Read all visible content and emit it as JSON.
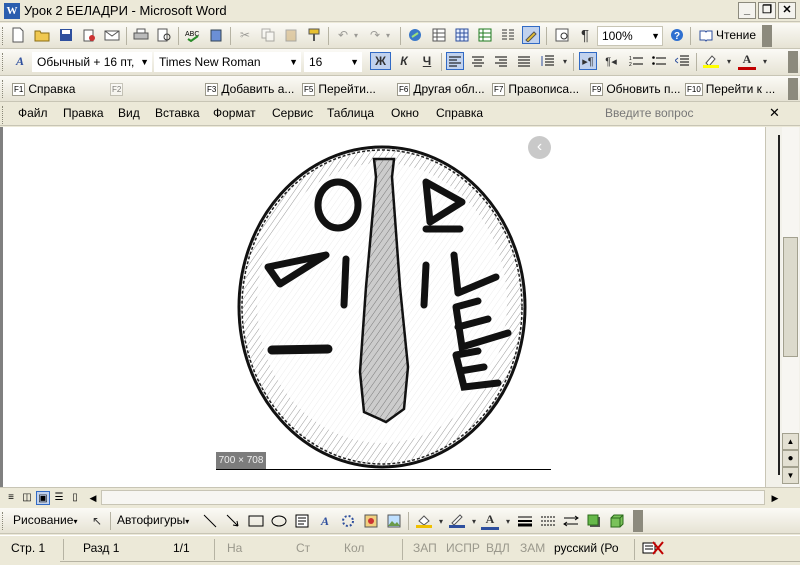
{
  "window": {
    "title": "Урок 2 БЕЛАДРИ - Microsoft Word",
    "min": "_",
    "max": "❐",
    "close": "✕"
  },
  "standard": {
    "zoom": "100%",
    "read_label": "Чтение"
  },
  "formatting": {
    "style": "Обычный + 16 пт,",
    "font": "Times New Roman",
    "size": "16",
    "bold": "Ж",
    "italic": "К",
    "underline": "Ч"
  },
  "fkeys": [
    {
      "key": "F1",
      "label": "Справка"
    },
    {
      "key": "F2",
      "label": ""
    },
    {
      "key": "F3",
      "label": "Добавить а..."
    },
    {
      "key": "F5",
      "label": "Перейти..."
    },
    {
      "key": "F6",
      "label": "Другая обл..."
    },
    {
      "key": "F7",
      "label": "Правописа..."
    },
    {
      "key": "F9",
      "label": "Обновить п..."
    },
    {
      "key": "F10",
      "label": "Перейти к ..."
    }
  ],
  "menu": [
    "Файл",
    "Правка",
    "Вид",
    "Вставка",
    "Формат",
    "Сервис",
    "Таблица",
    "Окно",
    "Справка"
  ],
  "ask_placeholder": "Введите вопрос",
  "document": {
    "image_size_label": "700 × 708",
    "back_glyph": "‹"
  },
  "drawing": {
    "draw_label": "Рисование",
    "autoshapes_label": "Автофигуры"
  },
  "status": {
    "page": "Стр.  1",
    "section": "Разд  1",
    "pages": "1/1",
    "at": "На",
    "line": "Ст",
    "col": "Кол",
    "rec": "ЗАП",
    "trk": "ИСПР",
    "ext": "ВДЛ",
    "ovr": "ЗАМ",
    "lang": "русский (Ро"
  }
}
